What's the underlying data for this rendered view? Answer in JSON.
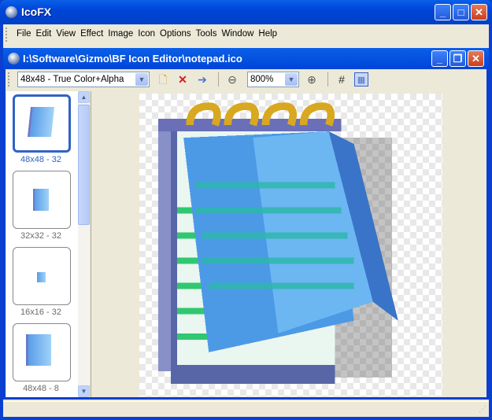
{
  "app": {
    "title": "IcoFX"
  },
  "menu": [
    "File",
    "Edit",
    "View",
    "Effect",
    "Image",
    "Icon",
    "Options",
    "Tools",
    "Window",
    "Help"
  ],
  "document": {
    "title": "I:\\Software\\Gizmo\\BF Icon Editor\\notepad.ico"
  },
  "toolbar": {
    "format": "48x48 - True Color+Alpha",
    "zoom": "800%"
  },
  "thumbnails": [
    {
      "label": "48x48 - 32",
      "selected": true
    },
    {
      "label": "32x32 - 32",
      "selected": false
    },
    {
      "label": "16x16 - 32",
      "selected": false
    },
    {
      "label": "48x48 - 8",
      "selected": false
    }
  ]
}
